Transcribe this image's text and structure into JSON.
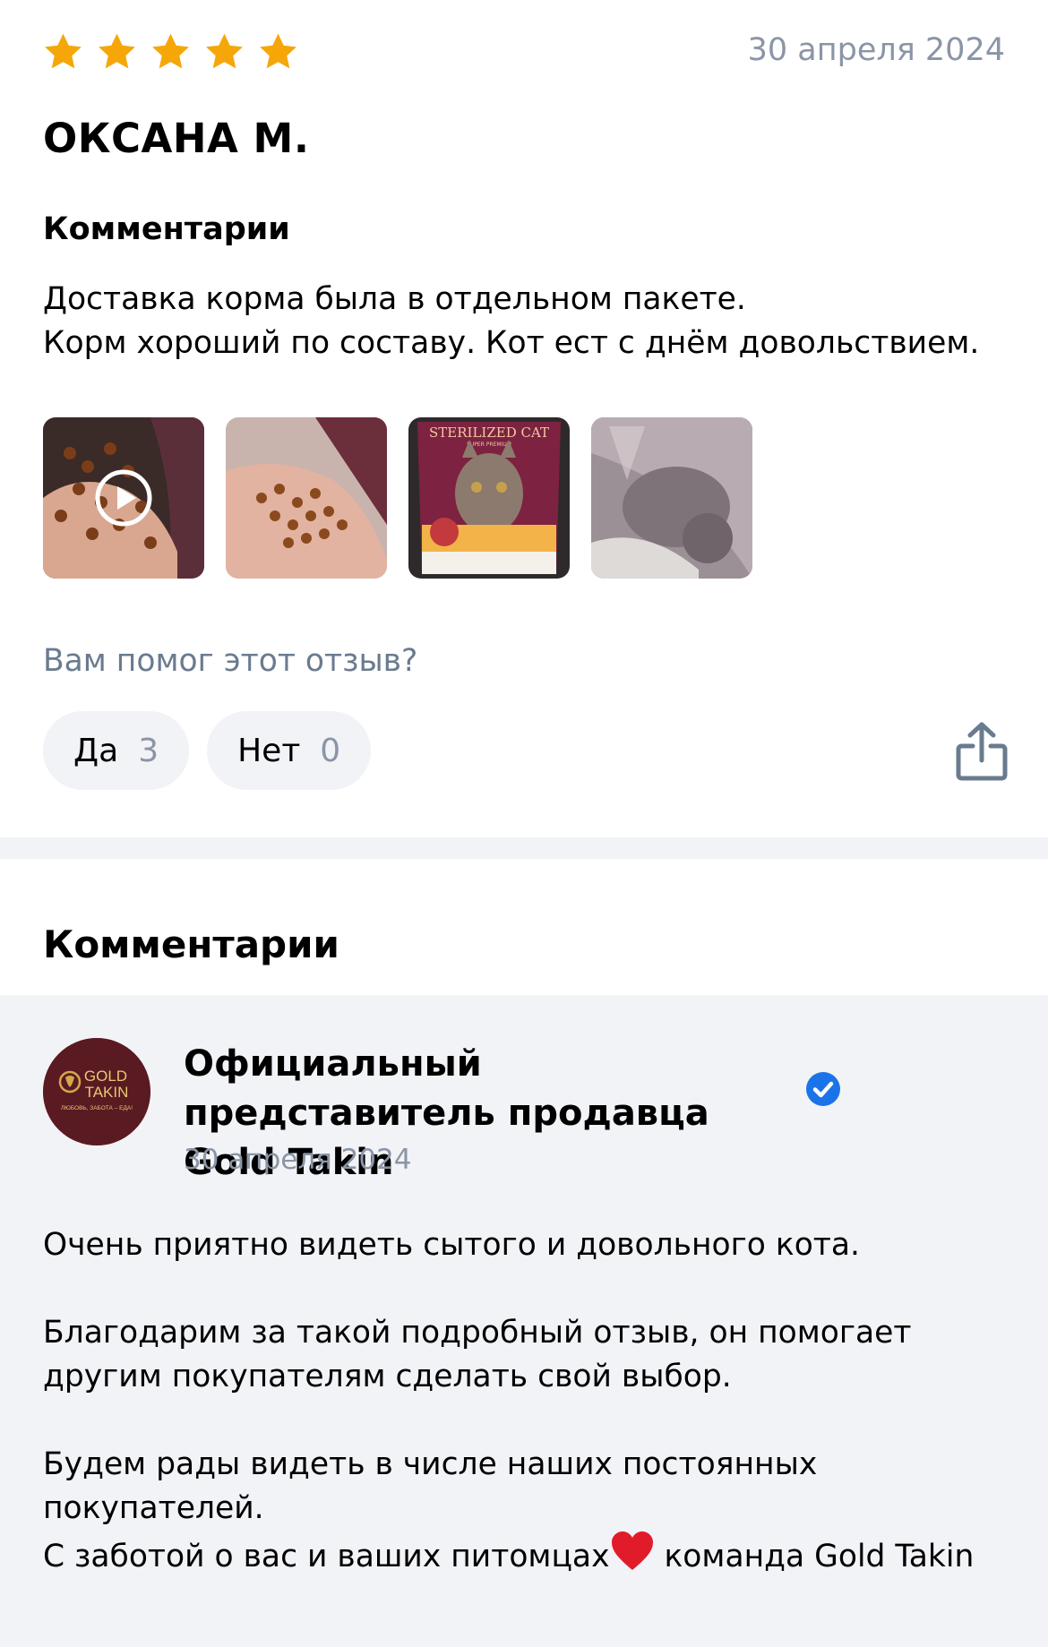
{
  "review": {
    "rating": 5,
    "date": "30 апреля 2024",
    "author": "ОКСАНА М.",
    "comments_label": "Комментарии",
    "text": "Доставка корма была в отдельном пакете.\nКорм хороший по составу. Кот ест с днём довольствием.",
    "media": [
      {
        "kind": "video",
        "icon": "play-icon"
      },
      {
        "kind": "photo"
      },
      {
        "kind": "photo",
        "package_title": "STERILIZED CAT",
        "package_subtitle": "SUPER PREMIUM"
      },
      {
        "kind": "photo"
      }
    ],
    "helpful_question": "Вам помог этот отзыв?",
    "vote_yes": {
      "label": "Да",
      "count": "3"
    },
    "vote_no": {
      "label": "Нет",
      "count": "0"
    },
    "share_icon": "share-icon"
  },
  "comments_section": {
    "title": "Комментарии",
    "reply": {
      "seller_logo": {
        "line1": "GOLD",
        "line2": "TAKIN",
        "tagline": "ЛЮБОВЬ, ЗАБОТА – ЕДА!"
      },
      "seller_name": "Официальный представитель продавца Gold Takin",
      "verified_icon": "verified-check-icon",
      "date": "30 апреля 2024",
      "paragraph1": "Очень приятно видеть сытого и довольного кота.",
      "paragraph2": "Благодарим за такой подробный отзыв, он помогает другим покупателям сделать свой выбор.",
      "paragraph3a": "Будем рады видеть в числе наших постоянных покупателей.\nС заботой о вас и ваших питомцах",
      "paragraph3b": " команда Gold Takin"
    }
  },
  "colors": {
    "star": "#f5a70a",
    "muted_text": "#8a95a6",
    "helpful_text": "#6a7b8f",
    "chip_bg": "#f2f3f7",
    "verified": "#1a73e8",
    "logo_bg": "#5a1a22"
  }
}
